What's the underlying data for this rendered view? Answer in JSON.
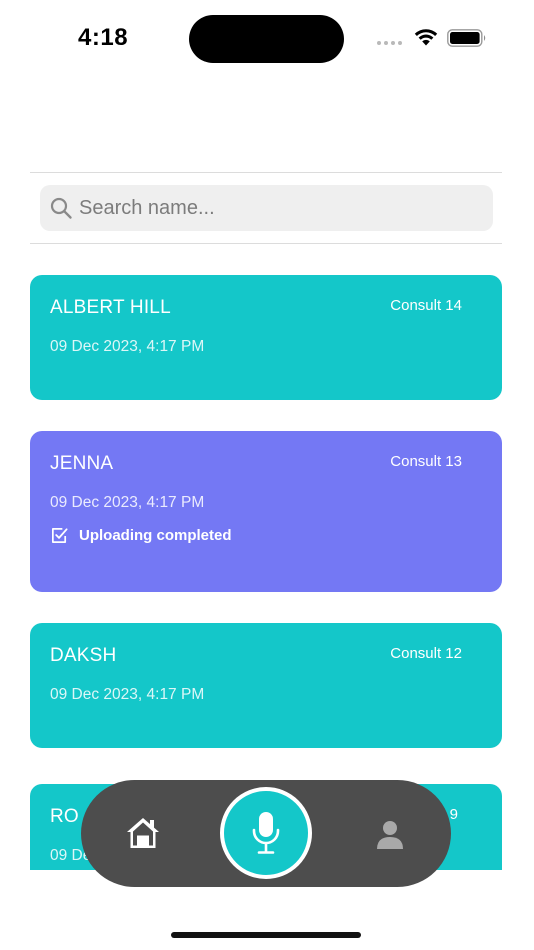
{
  "status_bar": {
    "time": "4:18"
  },
  "search": {
    "placeholder": "Search name..."
  },
  "consults": [
    {
      "name": "ALBERT HILL",
      "consult": "Consult 14",
      "date": "09 Dec 2023, 4:17 PM",
      "status": "",
      "color": "#14c7c9"
    },
    {
      "name": "JENNA",
      "consult": "Consult 13",
      "date": "09 Dec 2023, 4:17 PM",
      "status": "Uploading completed",
      "color": "#7478f4"
    },
    {
      "name": "DAKSH",
      "consult": "Consult 12",
      "date": "09 Dec 2023, 4:17 PM",
      "status": "",
      "color": "#14c7c9"
    },
    {
      "name": "RO",
      "consult": "9",
      "date": "09 De",
      "status": "",
      "color": "#14c7c9"
    }
  ],
  "tab_bar": {
    "items": [
      "home-icon",
      "microphone-icon",
      "profile-icon"
    ],
    "accent": "#14c7c9",
    "background": "#4d4d4d"
  }
}
